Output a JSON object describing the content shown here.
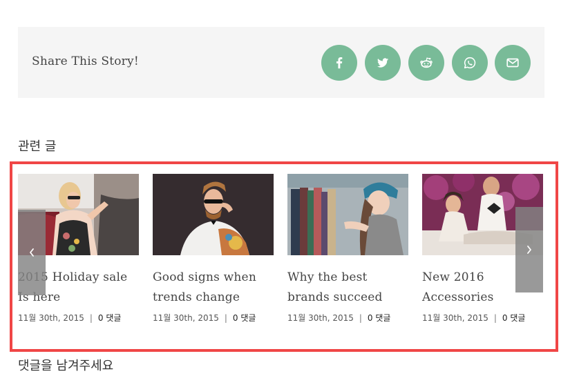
{
  "share": {
    "title": "Share This Story!",
    "buttons": [
      {
        "name": "facebook",
        "icon": "facebook-icon"
      },
      {
        "name": "twitter",
        "icon": "twitter-icon"
      },
      {
        "name": "reddit",
        "icon": "reddit-icon"
      },
      {
        "name": "whatsapp",
        "icon": "whatsapp-icon"
      },
      {
        "name": "email",
        "icon": "envelope-icon"
      }
    ],
    "button_color": "#79bb98"
  },
  "related": {
    "heading": "관련 글",
    "posts": [
      {
        "title": "2015 Holiday sale Is here",
        "date": "11월 30th, 2015",
        "separator": "|",
        "comments": "0 댓글"
      },
      {
        "title": "Good signs when trends change",
        "date": "11월 30th, 2015",
        "separator": "|",
        "comments": "0 댓글"
      },
      {
        "title": "Why the best brands succeed",
        "date": "11월 30th, 2015",
        "separator": "|",
        "comments": "0 댓글"
      },
      {
        "title": "New 2016 Accessories",
        "date": "11월 30th, 2015",
        "separator": "|",
        "comments": "0 댓글"
      }
    ],
    "prev_icon": "chevron-left-icon",
    "next_icon": "chevron-right-icon",
    "highlight_color": "#f04646"
  },
  "comments": {
    "heading": "댓글을 남겨주세요"
  }
}
